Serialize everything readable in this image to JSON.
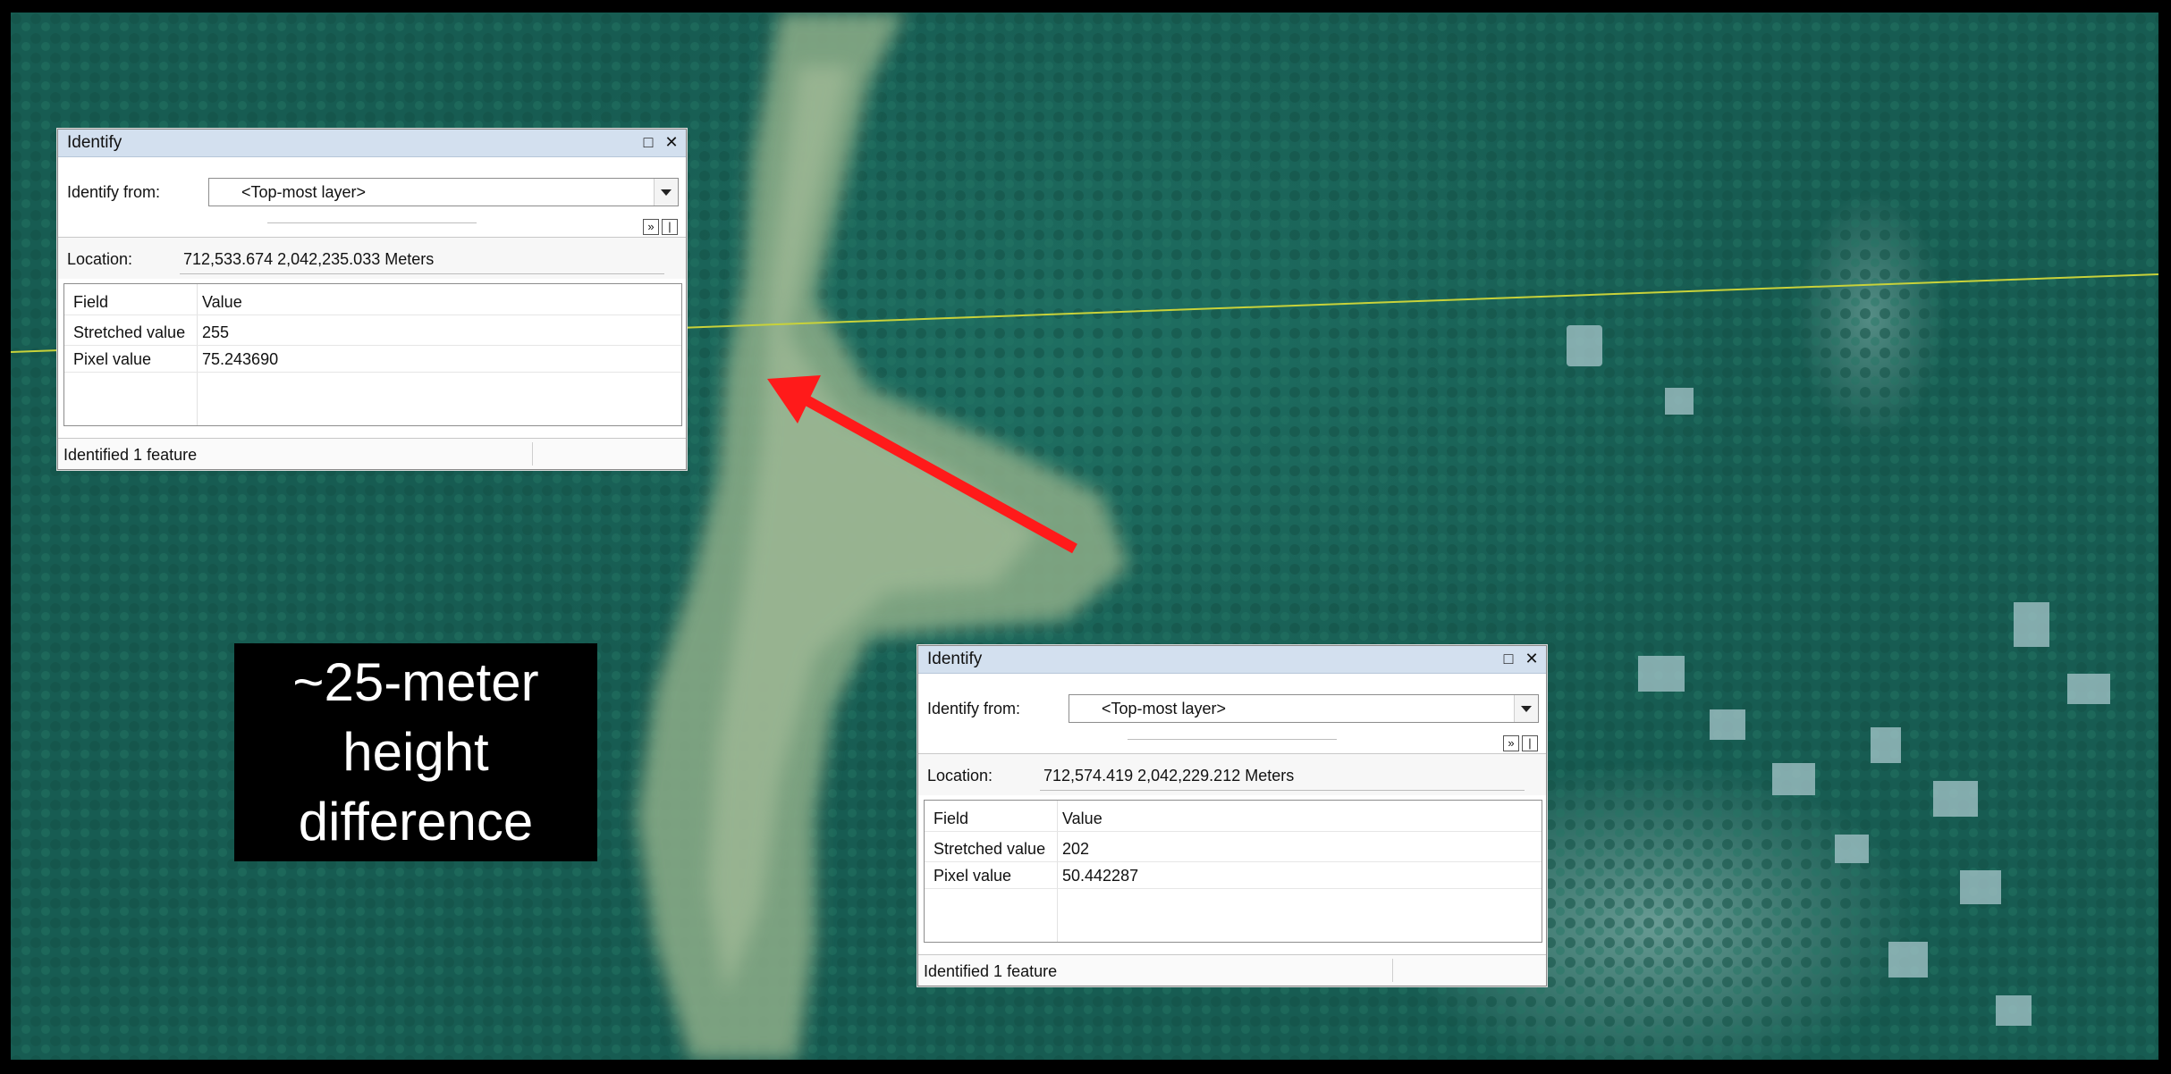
{
  "dialogs": [
    {
      "title": "Identify",
      "identify_from_label": "Identify from:",
      "identify_from_value": "<Top-most layer>",
      "location_label": "Location:",
      "location_value": "712,533.674  2,042,235.033 Meters",
      "columns": [
        "Field",
        "Value"
      ],
      "rows": [
        {
          "field": "Stretched value",
          "value": "255"
        },
        {
          "field": "Pixel value",
          "value": "75.243690"
        }
      ],
      "status": "Identified 1 feature"
    },
    {
      "title": "Identify",
      "identify_from_label": "Identify from:",
      "identify_from_value": "<Top-most layer>",
      "location_label": "Location:",
      "location_value": "712,574.419  2,042,229.212 Meters",
      "columns": [
        "Field",
        "Value"
      ],
      "rows": [
        {
          "field": "Stretched value",
          "value": "202"
        },
        {
          "field": "Pixel value",
          "value": "50.442287"
        }
      ],
      "status": "Identified 1 feature"
    }
  ],
  "callout": {
    "text": "~25-meter height difference"
  },
  "colors": {
    "forest": "#1a6156",
    "valley": "#8fb08a",
    "arrow": "#ff1a1a",
    "line": "#c8d23a",
    "titlebar": "#d3e0ef"
  },
  "icons": [
    "maximize-icon",
    "close-icon",
    "dropdown-arrow-icon",
    "expand-icon",
    "pin-icon"
  ]
}
